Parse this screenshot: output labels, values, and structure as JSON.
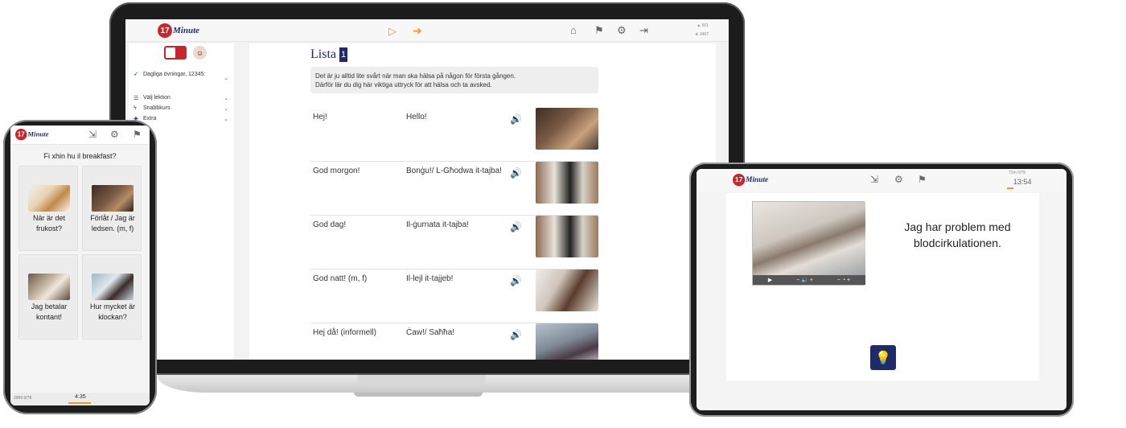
{
  "brand": {
    "logo_number": "17",
    "logo_text": "Minute"
  },
  "laptop": {
    "topbar": {
      "icons": [
        "play-icon",
        "arrow-right-icon",
        "home-icon",
        "flag-icon",
        "gear-icon",
        "logout-icon"
      ],
      "stats": [
        "501",
        "3467"
      ]
    },
    "sidebar": {
      "items": [
        {
          "label": "Dagliga övningar, 12345:",
          "icon": "rocket-icon"
        },
        {
          "label": "Välj lektion",
          "icon": "list-icon"
        },
        {
          "label": "Snabbkurs",
          "icon": "lightning-icon"
        },
        {
          "label": "Extra",
          "icon": "plus-icon"
        }
      ]
    },
    "main": {
      "title": "Lista",
      "title_number": "1",
      "intro_line1": "Det är ju alltid lite svårt när man ska hälsa på någon för första gången.",
      "intro_line2": "Därför lär du dig här viktiga uttryck för att hälsa och ta avsked.",
      "phrases": [
        {
          "sv": "Hej!",
          "mt": "Hello!"
        },
        {
          "sv": "God morgon!",
          "mt": "Bonġu!/ L-Għodwa it-tajba!"
        },
        {
          "sv": "God dag!",
          "mt": "Il-ġurnata it-tajba!"
        },
        {
          "sv": "God natt! (m, f)",
          "mt": "Il-lejl it-tajjeb!"
        },
        {
          "sv": "Hej då! (informell)",
          "mt": "Ċaw!/ Saħħa!"
        }
      ]
    }
  },
  "phone": {
    "question": "Fi xhin hu il breakfast?",
    "options": [
      {
        "label": "När är det frukost?"
      },
      {
        "label": "Förlåt / Jag är ledsen. (m, f)"
      },
      {
        "label": "Jag betalar kontant!"
      },
      {
        "label": "Hur mycket är klockan?"
      }
    ],
    "bottom_stats": "2960   0/78",
    "timer": "4:35"
  },
  "tablet": {
    "sentence": "Jag har problem med blodcirkulationen.",
    "timer": "13:54",
    "stats": "72m  0/78"
  },
  "colors": {
    "brand_blue": "#1f2a6b",
    "brand_red": "#c9252c",
    "accent_orange": "#e89a2c"
  }
}
